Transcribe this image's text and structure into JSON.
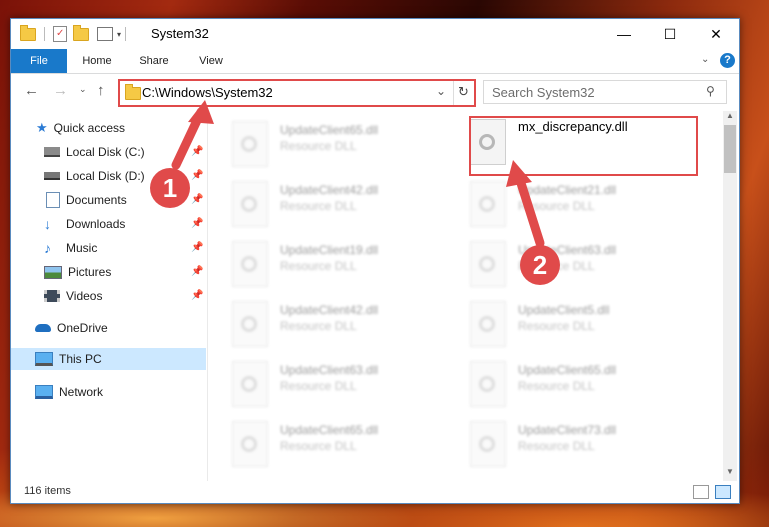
{
  "window": {
    "title": "System32",
    "controls": {
      "minimize": "—",
      "maximize": "☐",
      "close": "✕"
    }
  },
  "ribbon": {
    "tabs": [
      {
        "label": "File"
      },
      {
        "label": "Home"
      },
      {
        "label": "Share"
      },
      {
        "label": "View"
      }
    ],
    "help": "?"
  },
  "address": {
    "path": "C:\\Windows\\System32",
    "search_placeholder": "Search System32"
  },
  "sidebar": {
    "quick_access": "Quick access",
    "items": [
      {
        "label": "Local Disk (C:)",
        "icon": "drive-icon"
      },
      {
        "label": "Local Disk (D:)",
        "icon": "drive-icon"
      },
      {
        "label": "Documents",
        "icon": "documents-icon"
      },
      {
        "label": "Downloads",
        "icon": "downloads-icon"
      },
      {
        "label": "Music",
        "icon": "music-icon"
      },
      {
        "label": "Pictures",
        "icon": "pictures-icon"
      },
      {
        "label": "Videos",
        "icon": "videos-icon"
      }
    ],
    "onedrive": "OneDrive",
    "this_pc": "This PC",
    "network": "Network"
  },
  "files": {
    "highlighted": {
      "name": "mx_discrepancy.dll"
    },
    "left_column": [
      {
        "name": "UpdateClient65.dll",
        "type": "Resource DLL"
      },
      {
        "name": "UpdateClient42.dll",
        "type": "Resource DLL"
      },
      {
        "name": "UpdateClient19.dll",
        "type": "Resource DLL"
      },
      {
        "name": "UpdateClient42.dll",
        "type": "Resource DLL"
      },
      {
        "name": "UpdateClient63.dll",
        "type": "Resource DLL"
      },
      {
        "name": "UpdateClient65.dll",
        "type": "Resource DLL"
      }
    ],
    "right_column": [
      {
        "name": "UpdateClient21.dll",
        "type": "Resource DLL"
      },
      {
        "name": "UpdateClient63.dll",
        "type": "Resource DLL"
      },
      {
        "name": "UpdateClient5.dll",
        "type": "Resource DLL"
      },
      {
        "name": "UpdateClient65.dll",
        "type": "Resource DLL"
      },
      {
        "name": "UpdateClient73.dll",
        "type": "Resource DLL"
      }
    ]
  },
  "status": {
    "item_count": "116 items"
  },
  "callouts": {
    "one": "1",
    "two": "2"
  },
  "colors": {
    "accent": "#1979ca",
    "highlight_box": "#e04a4a",
    "selection": "#cce8ff"
  }
}
